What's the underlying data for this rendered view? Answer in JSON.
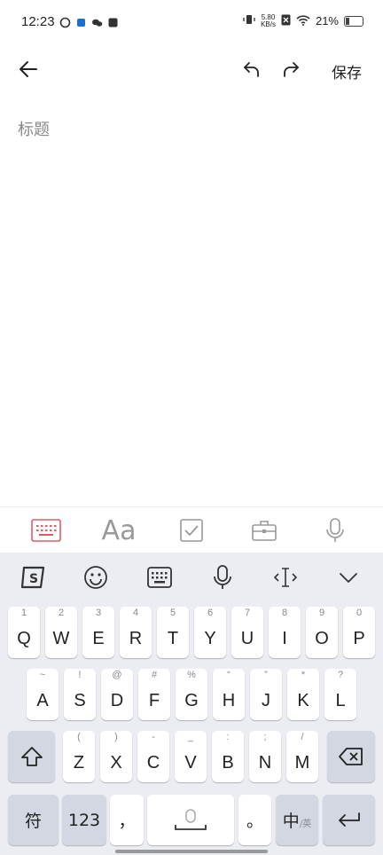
{
  "status": {
    "time": "12:23",
    "speed_top": "5.80",
    "speed_bottom": "KB/s",
    "battery": "21%"
  },
  "toolbar": {
    "save_label": "保存",
    "back_icon": "arrow-left-icon",
    "undo_icon": "undo-icon",
    "redo_icon": "redo-icon"
  },
  "editor": {
    "title_placeholder": "标题"
  },
  "format_bar": {
    "items": [
      "keyboard-icon",
      "text-format-icon",
      "checkbox-icon",
      "toolbox-icon",
      "microphone-icon"
    ],
    "text_icon_label": "Aa"
  },
  "keyboard": {
    "toolbar": [
      "sogou-logo-icon",
      "emoji-icon",
      "keyboard-icon",
      "microphone-icon",
      "cursor-icon",
      "collapse-icon"
    ],
    "row1": [
      {
        "main": "Q",
        "sub": "1"
      },
      {
        "main": "W",
        "sub": "2"
      },
      {
        "main": "E",
        "sub": "3"
      },
      {
        "main": "R",
        "sub": "4"
      },
      {
        "main": "T",
        "sub": "5"
      },
      {
        "main": "Y",
        "sub": "6"
      },
      {
        "main": "U",
        "sub": "7"
      },
      {
        "main": "I",
        "sub": "8"
      },
      {
        "main": "O",
        "sub": "9"
      },
      {
        "main": "P",
        "sub": "0"
      }
    ],
    "row2": [
      {
        "main": "A",
        "sub": "~"
      },
      {
        "main": "S",
        "sub": "!"
      },
      {
        "main": "D",
        "sub": "@"
      },
      {
        "main": "F",
        "sub": "#"
      },
      {
        "main": "G",
        "sub": "%"
      },
      {
        "main": "H",
        "sub": "“"
      },
      {
        "main": "J",
        "sub": "”"
      },
      {
        "main": "K",
        "sub": "*"
      },
      {
        "main": "L",
        "sub": "?"
      }
    ],
    "row3": [
      {
        "main": "Z",
        "sub": "("
      },
      {
        "main": "X",
        "sub": ")"
      },
      {
        "main": "C",
        "sub": "-"
      },
      {
        "main": "V",
        "sub": "_"
      },
      {
        "main": "B",
        "sub": ":"
      },
      {
        "main": "N",
        "sub": ";"
      },
      {
        "main": "M",
        "sub": "/"
      }
    ],
    "bottom": {
      "symbols": "符",
      "numbers": "123",
      "comma": "，",
      "period": "。",
      "lang_main": "中",
      "lang_sub": "/英"
    }
  }
}
